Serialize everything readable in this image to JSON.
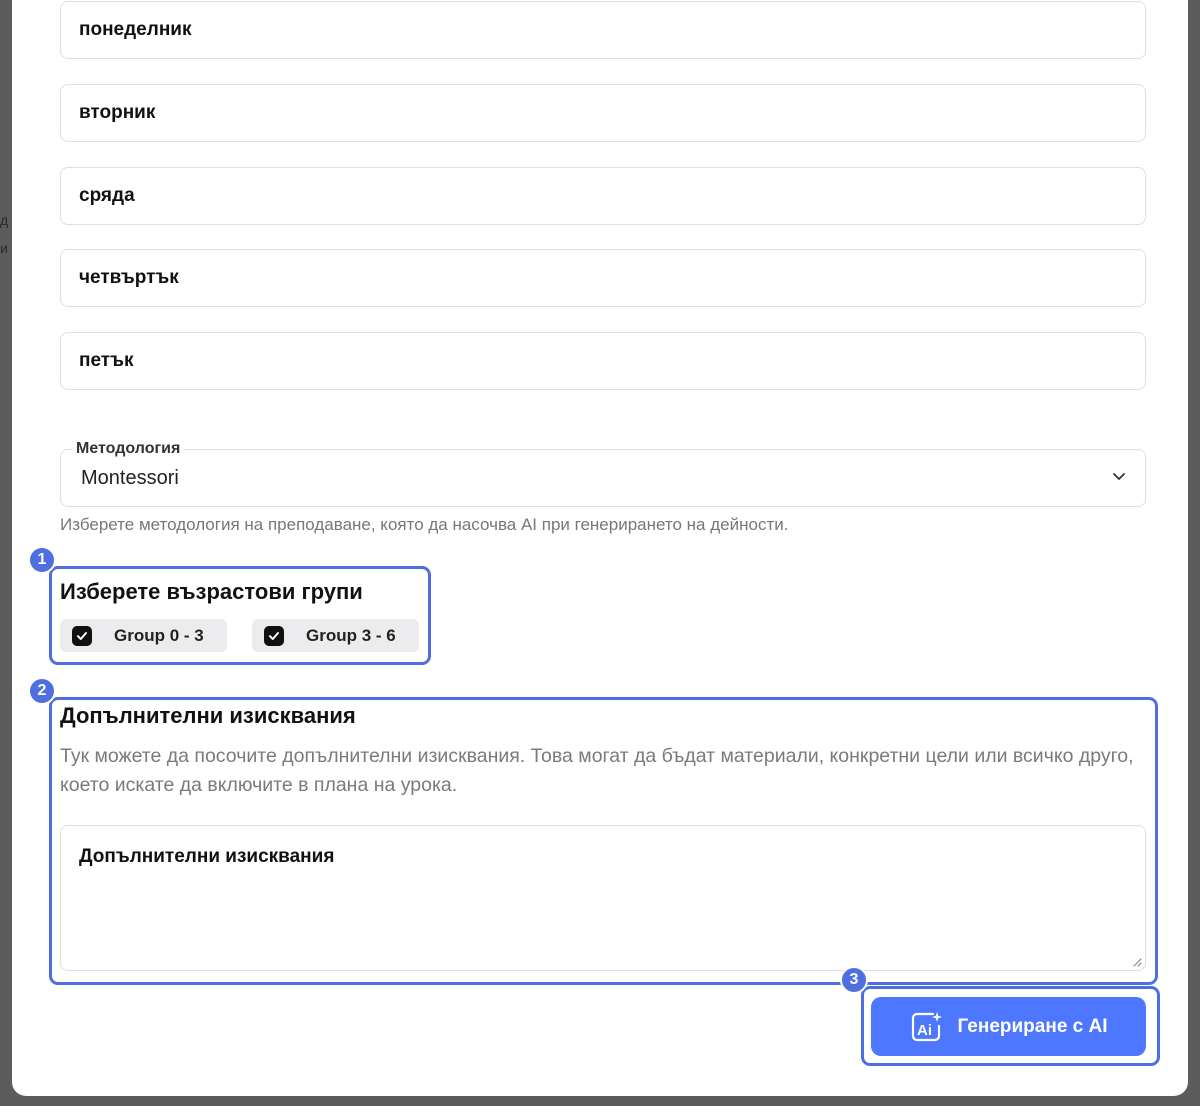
{
  "backdrop": {
    "left_glyph_1": "д",
    "left_glyph_2": "и"
  },
  "days": [
    "понеделник",
    "вторник",
    "сряда",
    "четвъртък",
    "петък"
  ],
  "methodology": {
    "label": "Методология",
    "value": "Montessori",
    "helper": "Изберете методология на преподаване, която да насочва AI при генерирането на дейности."
  },
  "age_groups": {
    "title": "Изберете възрастови групи",
    "options": [
      {
        "label": "Group 0 - 3",
        "checked": true
      },
      {
        "label": "Group 3 - 6",
        "checked": true
      }
    ]
  },
  "requirements": {
    "title": "Допълнителни изисквания",
    "description": "Тук можете да посочите допълнителни изисквания. Това могат да бъдат материали, конкретни цели или всичко друго, което искате да включите в плана на урока.",
    "placeholder": "Допълнителни изисквания"
  },
  "generate_button": {
    "label": "Генериране с AI",
    "icon": "ai-sparkle-icon"
  },
  "highlights": [
    "1",
    "2",
    "3"
  ],
  "colors": {
    "accent": "#4d77ff",
    "highlight": "#4f6fe0"
  }
}
